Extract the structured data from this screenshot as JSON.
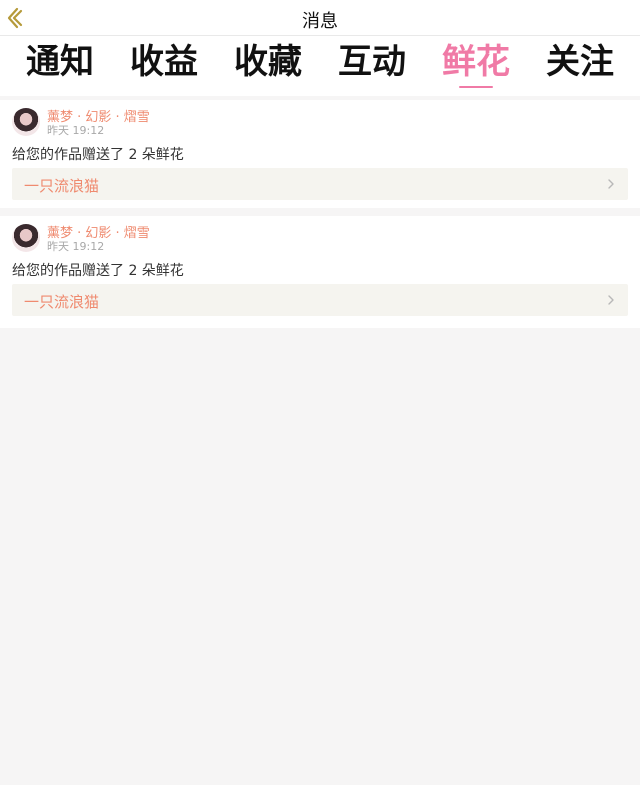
{
  "header": {
    "title": "消息",
    "back_icon": "chevron-left-icon"
  },
  "tabs": [
    {
      "label": "通知",
      "active": false
    },
    {
      "label": "收益",
      "active": false
    },
    {
      "label": "收藏",
      "active": false
    },
    {
      "label": "互动",
      "active": false
    },
    {
      "label": "鲜花",
      "active": true
    },
    {
      "label": "关注",
      "active": false
    }
  ],
  "colors": {
    "accent": "#f07aa6",
    "username": "#ef8a6f",
    "link_bg": "#f5f4ef",
    "background": "#f6f5f5"
  },
  "messages": [
    {
      "user": "薰梦 · 幻影 · 熠雪",
      "time": "昨天 19:12",
      "text": "给您的作品赠送了 2 朵鲜花",
      "work": "一只流浪猫"
    },
    {
      "user": "薰梦 · 幻影 · 熠雪",
      "time": "昨天 19:12",
      "text": "给您的作品赠送了 2 朵鲜花",
      "work": "一只流浪猫"
    }
  ]
}
